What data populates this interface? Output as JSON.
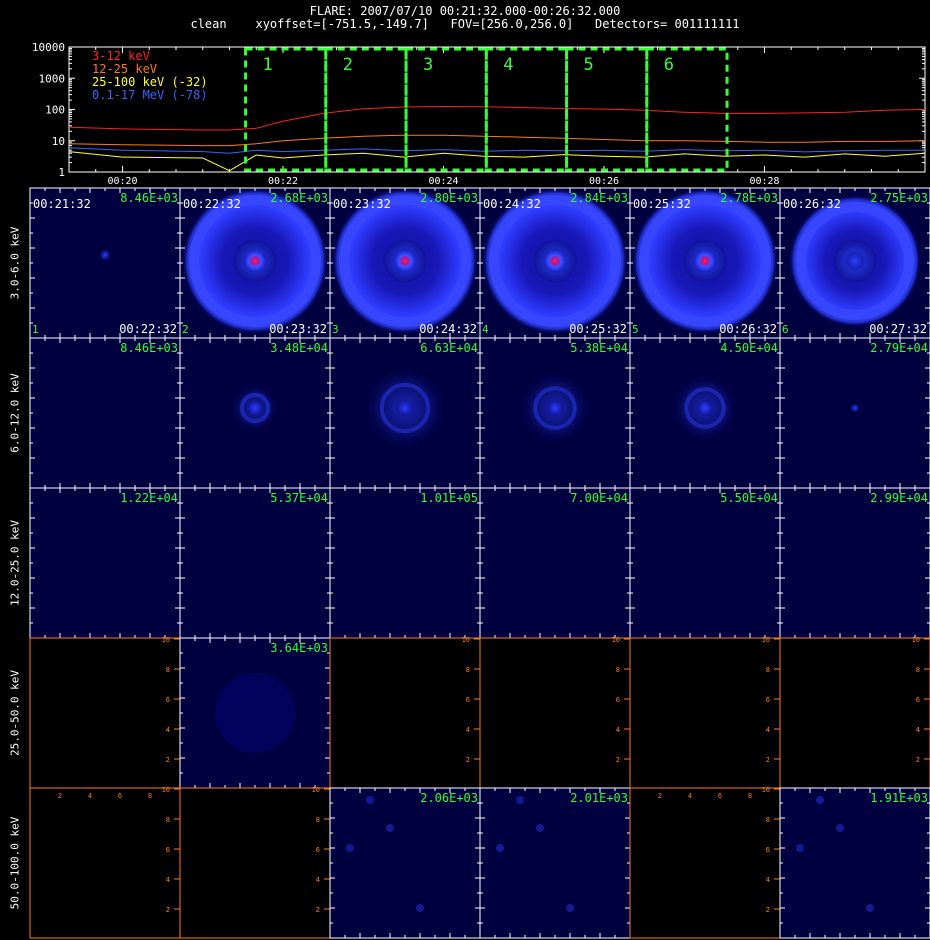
{
  "header": {
    "line1": "FLARE: 2007/07/10 00:21:32.000-00:26:32.000",
    "line2": "clean    xyoffset=[-751.5,-149.7]   FOV=[256.0,256.0]   Detectors= 001111111"
  },
  "colors": {
    "green": "#33ff33",
    "red": "#ff2020",
    "orange": "#ff7a1a",
    "yellow": "#ffff33",
    "blue": "#3366ff",
    "white": "#ffffff",
    "panel_bg": "#000040"
  },
  "chart_data": [
    {
      "type": "line",
      "title": "",
      "xlabel": "",
      "ylabel": "",
      "yscale": "log",
      "ylim": [
        1,
        10000
      ],
      "xlim": [
        "00:19:20",
        "00:30:00"
      ],
      "ytick_labels": [
        "1",
        "10",
        "100",
        "1000",
        "10000"
      ],
      "xtick_labels": [
        "00:20",
        "00:22",
        "00:24",
        "00:26",
        "00:28"
      ],
      "x": [
        "00:19:20",
        "00:20:00",
        "00:21:00",
        "00:21:20",
        "00:21:40",
        "00:22:00",
        "00:22:30",
        "00:23:00",
        "00:23:30",
        "00:24:00",
        "00:24:30",
        "00:25:00",
        "00:25:30",
        "00:26:00",
        "00:26:30",
        "00:27:00",
        "00:27:30",
        "00:28:00",
        "00:28:30",
        "00:29:00",
        "00:29:30",
        "00:30:00"
      ],
      "series": [
        {
          "name": "3-12 keV",
          "color": "#ff2020",
          "values": [
            27,
            24,
            22,
            22,
            25,
            42,
            75,
            105,
            120,
            125,
            122,
            115,
            108,
            103,
            95,
            82,
            75,
            75,
            78,
            82,
            95,
            100
          ]
        },
        {
          "name": "12-25 keV",
          "color": "#ff7a1a",
          "values": [
            8,
            7.5,
            7,
            7,
            8,
            10,
            12,
            14,
            15,
            15,
            14,
            13,
            12,
            11,
            10,
            10,
            9.5,
            9,
            9,
            9.5,
            9.5,
            10
          ]
        },
        {
          "name": "25-100 keV (-32)",
          "color": "#ffff33",
          "values": [
            4.5,
            3,
            2.8,
            1.1,
            3.5,
            2.8,
            3.5,
            4,
            3,
            4,
            3.2,
            3,
            3.6,
            3.2,
            3,
            3.8,
            3.2,
            3.5,
            3,
            3.8,
            3.2,
            4
          ]
        },
        {
          "name": "0.1-17 MeV (-78)",
          "color": "#3366ff",
          "values": [
            6,
            5,
            4.5,
            4,
            5,
            4.5,
            5,
            5.5,
            4.8,
            5.2,
            4.6,
            5,
            4.8,
            5,
            4.6,
            5.2,
            4.8,
            5,
            4.4,
            4.8,
            5,
            5
          ]
        }
      ],
      "legend": [
        "3-12 keV",
        "12-25 keV",
        "25-100 keV (-32)",
        "0.1-17 MeV (-78)"
      ],
      "legend_position": "top-left",
      "intervals": [
        {
          "label": "1",
          "start": "00:21:32",
          "end": "00:22:32"
        },
        {
          "label": "2",
          "start": "00:22:32",
          "end": "00:23:32"
        },
        {
          "label": "3",
          "start": "00:23:32",
          "end": "00:24:32"
        },
        {
          "label": "4",
          "start": "00:24:32",
          "end": "00:25:32"
        },
        {
          "label": "5",
          "start": "00:25:32",
          "end": "00:26:32"
        },
        {
          "label": "6",
          "start": "00:26:32",
          "end": "00:27:32"
        }
      ]
    },
    {
      "type": "heatmap",
      "title": "",
      "rows": [
        "3.0-6.0 keV",
        "6.0-12.0 keV",
        "12.0-25.0 keV",
        "25.0-50.0 keV",
        "50.0-100.0 keV"
      ],
      "columns": [
        "1",
        "2",
        "3",
        "4",
        "5",
        "6"
      ],
      "start_times": [
        "00:21:32",
        "00:22:32",
        "00:23:32",
        "00:24:32",
        "00:25:32",
        "00:26:32"
      ],
      "end_times": [
        "00:22:32",
        "00:23:32",
        "00:24:32",
        "00:25:32",
        "00:26:32",
        "00:27:32"
      ],
      "max_values": [
        [
          "8.46E+03",
          "2.68E+03",
          "2.80E+03",
          "2.84E+03",
          "2.78E+03",
          "2.75E+03"
        ],
        [
          "8.46E+03",
          "3.48E+04",
          "6.63E+04",
          "5.38E+04",
          "4.50E+04",
          "2.79E+04"
        ],
        [
          "1.22E+04",
          "5.37E+04",
          "1.01E+05",
          "7.00E+04",
          "5.50E+04",
          "2.99E+04"
        ],
        [
          "",
          "3.64E+03",
          "",
          "",
          "",
          ""
        ],
        [
          "",
          "",
          "2.06E+03",
          "2.01E+03",
          "",
          "1.91E+03"
        ]
      ],
      "image_available": [
        [
          true,
          true,
          true,
          true,
          true,
          true
        ],
        [
          true,
          true,
          true,
          true,
          true,
          true
        ],
        [
          true,
          true,
          true,
          true,
          true,
          true
        ],
        [
          false,
          true,
          false,
          false,
          false,
          false
        ],
        [
          false,
          false,
          true,
          true,
          false,
          true
        ]
      ],
      "blank_axis_ticks": [
        "2",
        "4",
        "6",
        "8",
        "10"
      ]
    }
  ]
}
